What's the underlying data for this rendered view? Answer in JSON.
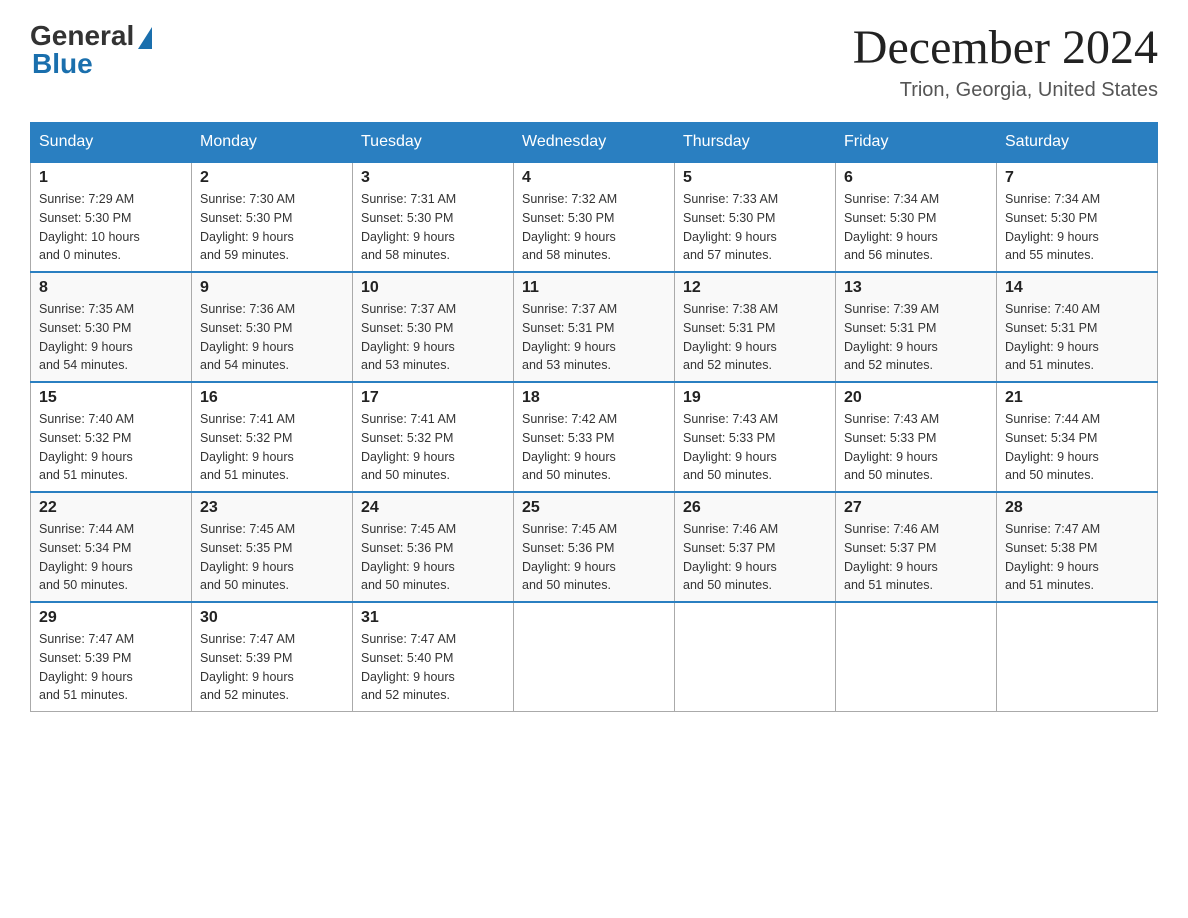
{
  "header": {
    "logo": {
      "general": "General",
      "blue": "Blue"
    },
    "title": "December 2024",
    "location": "Trion, Georgia, United States"
  },
  "days_of_week": [
    "Sunday",
    "Monday",
    "Tuesday",
    "Wednesday",
    "Thursday",
    "Friday",
    "Saturday"
  ],
  "weeks": [
    [
      {
        "day": "1",
        "sunrise": "7:29 AM",
        "sunset": "5:30 PM",
        "daylight": "10 hours and 0 minutes."
      },
      {
        "day": "2",
        "sunrise": "7:30 AM",
        "sunset": "5:30 PM",
        "daylight": "9 hours and 59 minutes."
      },
      {
        "day": "3",
        "sunrise": "7:31 AM",
        "sunset": "5:30 PM",
        "daylight": "9 hours and 58 minutes."
      },
      {
        "day": "4",
        "sunrise": "7:32 AM",
        "sunset": "5:30 PM",
        "daylight": "9 hours and 58 minutes."
      },
      {
        "day": "5",
        "sunrise": "7:33 AM",
        "sunset": "5:30 PM",
        "daylight": "9 hours and 57 minutes."
      },
      {
        "day": "6",
        "sunrise": "7:34 AM",
        "sunset": "5:30 PM",
        "daylight": "9 hours and 56 minutes."
      },
      {
        "day": "7",
        "sunrise": "7:34 AM",
        "sunset": "5:30 PM",
        "daylight": "9 hours and 55 minutes."
      }
    ],
    [
      {
        "day": "8",
        "sunrise": "7:35 AM",
        "sunset": "5:30 PM",
        "daylight": "9 hours and 54 minutes."
      },
      {
        "day": "9",
        "sunrise": "7:36 AM",
        "sunset": "5:30 PM",
        "daylight": "9 hours and 54 minutes."
      },
      {
        "day": "10",
        "sunrise": "7:37 AM",
        "sunset": "5:30 PM",
        "daylight": "9 hours and 53 minutes."
      },
      {
        "day": "11",
        "sunrise": "7:37 AM",
        "sunset": "5:31 PM",
        "daylight": "9 hours and 53 minutes."
      },
      {
        "day": "12",
        "sunrise": "7:38 AM",
        "sunset": "5:31 PM",
        "daylight": "9 hours and 52 minutes."
      },
      {
        "day": "13",
        "sunrise": "7:39 AM",
        "sunset": "5:31 PM",
        "daylight": "9 hours and 52 minutes."
      },
      {
        "day": "14",
        "sunrise": "7:40 AM",
        "sunset": "5:31 PM",
        "daylight": "9 hours and 51 minutes."
      }
    ],
    [
      {
        "day": "15",
        "sunrise": "7:40 AM",
        "sunset": "5:32 PM",
        "daylight": "9 hours and 51 minutes."
      },
      {
        "day": "16",
        "sunrise": "7:41 AM",
        "sunset": "5:32 PM",
        "daylight": "9 hours and 51 minutes."
      },
      {
        "day": "17",
        "sunrise": "7:41 AM",
        "sunset": "5:32 PM",
        "daylight": "9 hours and 50 minutes."
      },
      {
        "day": "18",
        "sunrise": "7:42 AM",
        "sunset": "5:33 PM",
        "daylight": "9 hours and 50 minutes."
      },
      {
        "day": "19",
        "sunrise": "7:43 AM",
        "sunset": "5:33 PM",
        "daylight": "9 hours and 50 minutes."
      },
      {
        "day": "20",
        "sunrise": "7:43 AM",
        "sunset": "5:33 PM",
        "daylight": "9 hours and 50 minutes."
      },
      {
        "day": "21",
        "sunrise": "7:44 AM",
        "sunset": "5:34 PM",
        "daylight": "9 hours and 50 minutes."
      }
    ],
    [
      {
        "day": "22",
        "sunrise": "7:44 AM",
        "sunset": "5:34 PM",
        "daylight": "9 hours and 50 minutes."
      },
      {
        "day": "23",
        "sunrise": "7:45 AM",
        "sunset": "5:35 PM",
        "daylight": "9 hours and 50 minutes."
      },
      {
        "day": "24",
        "sunrise": "7:45 AM",
        "sunset": "5:36 PM",
        "daylight": "9 hours and 50 minutes."
      },
      {
        "day": "25",
        "sunrise": "7:45 AM",
        "sunset": "5:36 PM",
        "daylight": "9 hours and 50 minutes."
      },
      {
        "day": "26",
        "sunrise": "7:46 AM",
        "sunset": "5:37 PM",
        "daylight": "9 hours and 50 minutes."
      },
      {
        "day": "27",
        "sunrise": "7:46 AM",
        "sunset": "5:37 PM",
        "daylight": "9 hours and 51 minutes."
      },
      {
        "day": "28",
        "sunrise": "7:47 AM",
        "sunset": "5:38 PM",
        "daylight": "9 hours and 51 minutes."
      }
    ],
    [
      {
        "day": "29",
        "sunrise": "7:47 AM",
        "sunset": "5:39 PM",
        "daylight": "9 hours and 51 minutes."
      },
      {
        "day": "30",
        "sunrise": "7:47 AM",
        "sunset": "5:39 PM",
        "daylight": "9 hours and 52 minutes."
      },
      {
        "day": "31",
        "sunrise": "7:47 AM",
        "sunset": "5:40 PM",
        "daylight": "9 hours and 52 minutes."
      },
      null,
      null,
      null,
      null
    ]
  ],
  "labels": {
    "sunrise": "Sunrise:",
    "sunset": "Sunset:",
    "daylight": "Daylight:"
  }
}
